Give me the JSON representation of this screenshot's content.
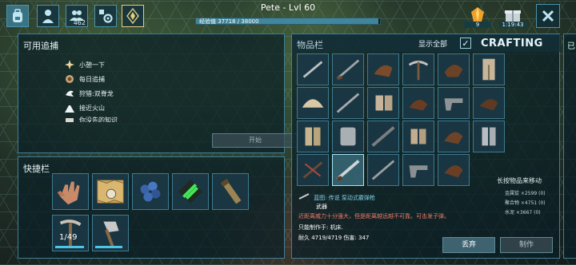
{
  "topbar": {
    "player_name": "Pete - Lvl 60",
    "xp_text": "经验值 37718 / 38000",
    "xp_progress": 0.993,
    "tribe_count": "462",
    "icons": [
      "backpack-icon",
      "character-icon",
      "tribe-icon",
      "settings-icon",
      "engram-icon"
    ],
    "element_count": "9",
    "gift_timer": "1:19:43"
  },
  "track_panel": {
    "title": "可用追捕",
    "items": [
      {
        "label": "小憩一下",
        "icon": "star-icon"
      },
      {
        "label": "每日追捕",
        "icon": "gear-medal-icon"
      },
      {
        "label": "狩猎:双脊龙",
        "icon": "dilo-icon"
      },
      {
        "label": "接近火山",
        "icon": "volcano-icon"
      },
      {
        "label": "你没先的知识",
        "icon": "scroll-icon"
      }
    ],
    "start_label": "开始"
  },
  "hotbar": {
    "title": "快捷栏",
    "slots": [
      {
        "name": "hand-slot",
        "qty": "",
        "durability": null
      },
      {
        "name": "map-slot",
        "qty": "",
        "durability": null
      },
      {
        "name": "berries-slot",
        "qty": "",
        "durability": null
      },
      {
        "name": "gps-slot",
        "qty": "",
        "durability": null
      },
      {
        "name": "spyglass-slot",
        "qty": "",
        "durability": null
      },
      {
        "name": "pick-slot",
        "qty": "1/49",
        "durability": 0.95
      },
      {
        "name": "hatchet-slot",
        "qty": "",
        "durability": 0.9
      }
    ]
  },
  "inventory": {
    "title": "物品栏",
    "show_all_label": "显示全部",
    "show_all_checked": "✓",
    "crafting_label": "CRAFTING",
    "hint": "长按物品来移动",
    "resources": [
      {
        "label": "金属锭 ×2599 (0)"
      },
      {
        "label": "聚合物 ×4751 (0)"
      },
      {
        "label": "水泥 ×3667 (0)"
      }
    ],
    "selected": {
      "name": "蓝图: 传说 泵动式霰弹枪",
      "type": "武器",
      "desc": "近距离威力十分强大，但是距离越远越不可靠。可击发子弹。",
      "requires": "只能制作于: 机床.",
      "stats": "耐久 4719/4719  伤害: 347"
    },
    "drop_label": "丢弃",
    "craft_label": "制作"
  },
  "right_panel": {
    "title": "已"
  },
  "colors": {
    "panel_border": "#3e8096",
    "accent": "#4da7c8",
    "red_text": "#f07b6b",
    "blue_text": "#7fd0e8"
  }
}
